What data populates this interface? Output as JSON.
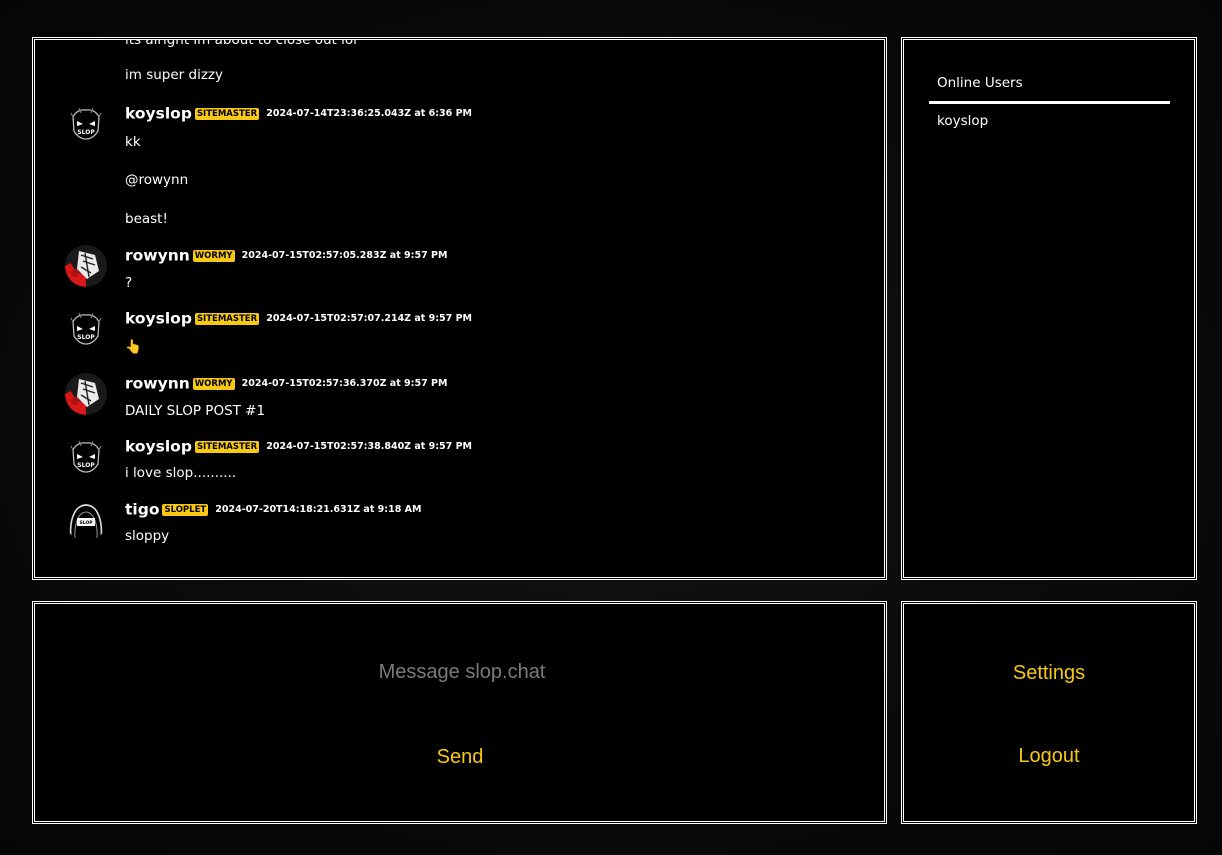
{
  "chat": {
    "partial_line": "its alright im about to close out lol",
    "pre_lines": [
      "im super dizzy"
    ],
    "messages": [
      {
        "user": "koyslop",
        "badge": "SITEMASTER",
        "timestamp": "2024-07-14T23:36:25.043Z at 6:36 PM",
        "lines": [
          "kk",
          "@rowynn",
          "beast!"
        ],
        "avatar": "slop-face-avatar"
      },
      {
        "user": "rowynn",
        "badge": "WORMY",
        "timestamp": "2024-07-15T02:57:05.283Z at 9:57 PM",
        "lines": [
          "?"
        ],
        "avatar": "red-art-avatar"
      },
      {
        "user": "koyslop",
        "badge": "SITEMASTER",
        "timestamp": "2024-07-15T02:57:07.214Z at 9:57 PM",
        "lines": [
          "👆"
        ],
        "avatar": "slop-face-avatar"
      },
      {
        "user": "rowynn",
        "badge": "WORMY",
        "timestamp": "2024-07-15T02:57:36.370Z at 9:57 PM",
        "lines": [
          "DAILY SLOP POST #1"
        ],
        "avatar": "red-art-avatar"
      },
      {
        "user": "koyslop",
        "badge": "SITEMASTER",
        "timestamp": "2024-07-15T02:57:38.840Z at 9:57 PM",
        "lines": [
          "i love slop.........."
        ],
        "avatar": "slop-face-avatar"
      },
      {
        "user": "tigo",
        "badge": "SLOPLET",
        "timestamp": "2024-07-20T14:18:21.631Z at 9:18 AM",
        "lines": [
          "sloppy"
        ],
        "avatar": "hooded-avatar"
      }
    ]
  },
  "online_users": {
    "title": "Online Users",
    "users": [
      "koyslop"
    ]
  },
  "composer": {
    "placeholder": "Message slop.chat",
    "send_label": "Send"
  },
  "actions": {
    "settings_label": "Settings",
    "logout_label": "Logout"
  },
  "colors": {
    "accent": "#f7c914",
    "panel_bg": "#000000",
    "border": "#ffffff"
  }
}
